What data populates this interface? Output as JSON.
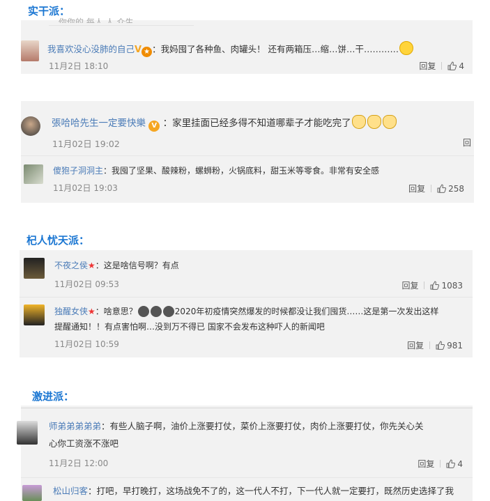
{
  "sections": {
    "s1": "实干派：",
    "s2": "杞人忧天派：",
    "s3": "激进派："
  },
  "p1": {
    "cut_text": "你你的 每人 人 众生",
    "c1": {
      "user": "我喜欢没心没肺的自己",
      "text": "：我妈囤了各种鱼、肉罐头！ 还有两箱压…缩…饼…干…………",
      "time": "11月2日 18:10",
      "reply": "回复",
      "likes": "4"
    }
  },
  "p2": {
    "c1": {
      "user": "張哈哈先生一定要快樂",
      "text": "：家里挂面已经多得不知道哪辈子才能吃完了",
      "time": "11月02日 19:02",
      "reply": "回"
    },
    "c2": {
      "user": "傻狍子洞洞主",
      "text": "：我囤了坚果、酸辣粉，螺蛳粉，火锅底料，甜玉米等零食。非常有安全感",
      "time": "11月02日 19:03",
      "reply": "回复",
      "likes": "258"
    }
  },
  "p3": {
    "c1": {
      "user": "不夜之侯",
      "text": "：这是啥信号啊？有点",
      "time": "11月02日 09:53",
      "reply": "回复",
      "likes": "1083"
    },
    "c2": {
      "user": "独醒女侠",
      "text_a": "：啥意思？",
      "text_b": "2020年初疫情突然爆发的时候都没让我们囤货……这是第一次发出这样",
      "text_c": "提醒通知！！有点害怕啊…没到万不得已 国家不会发布这种吓人的新闻吧",
      "time": "11月02日 10:59",
      "reply": "回复",
      "likes": "981"
    }
  },
  "p4": {
    "c1": {
      "user": "师弟弟弟弟弟",
      "text_a": "：有些人脑子啊，油价上涨要打仗，菜价上涨要打仗，肉价上涨要打仗，你先关心关",
      "text_b": "心你工资涨不涨吧",
      "time": "11月2日 12:00",
      "reply": "回复",
      "likes": "4"
    },
    "c2": {
      "user": "松山归客",
      "text": "：打吧，早打晚打，这场战免不了的，这一代人不打，下一代人就一定要打，既然历史选择了我"
    }
  },
  "colors": {
    "accent": "#1a76d2",
    "username": "#4a7bb7",
    "panel": "#f2f2f2"
  }
}
